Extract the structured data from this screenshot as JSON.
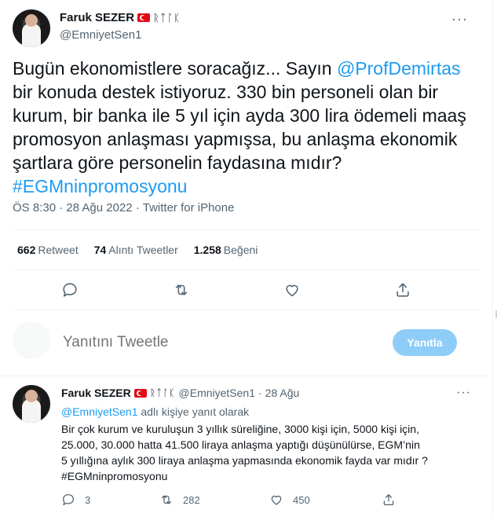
{
  "tweet": {
    "author": {
      "name": "Faruk SEZER",
      "script_text": "ᚱᛏᛚᛕ",
      "handle": "@EmniyetSen1"
    },
    "more_label": "···",
    "text_before_mention": "Bugün ekonomistlere soracağız... Sayın ",
    "mention": "@ProfDemirtas",
    "text_after_mention": " bir konuda destek istiyoruz. 330 bin personeli olan bir kurum, bir banka ile 5 yıl için ayda 300 lira ödemeli maaş promosyon anlaşması yapmışsa, bu anlaşma ekonomik şartlara göre personelin faydasına mıdır?",
    "hashtag": "#EGMninpromosyonu",
    "time": "ÖS 8:30",
    "separator": "·",
    "date": "28 Ağu 2022",
    "source": "Twitter for iPhone",
    "stats": {
      "retweets_count": "662",
      "retweets_label": "Retweet",
      "quotes_count": "74",
      "quotes_label": "Alıntı Tweetler",
      "likes_count": "1.258",
      "likes_label": "Beğeni"
    },
    "actions": [
      "reply-icon",
      "retweet-icon",
      "like-icon",
      "share-icon"
    ]
  },
  "compose": {
    "placeholder": "Yanıtını Tweetle",
    "button_label": "Yanıtla"
  },
  "reply": {
    "author": {
      "name": "Faruk SEZER",
      "script_text": "ᚱᛏᛚᛕ",
      "handle": "@EmniyetSen1"
    },
    "separator": "·",
    "date": "28 Ağu",
    "more_label": "···",
    "replying_to_handle": "@EmniyetSen1",
    "replying_to_suffix": " adlı kişiye yanıt olarak",
    "lines": [
      "Bir çok kurum ve kuruluşun 3 yıllık süreliğine, 3000 kişi için, 5000 kişi için,",
      "25.000, 30.000 hatta 41.500 liraya anlaşma yaptığı düşünülürse, EGM’nin",
      "5 yıllığına aylık 300 liraya anlaşma yapmasında ekonomik fayda var mıdır ?"
    ],
    "hashtag": "#EGMninpromosyonu",
    "reply_count": "3",
    "retweet_count": "282",
    "like_count": "450"
  },
  "colors": {
    "accent": "#1d9bf0",
    "text": "#0f1419",
    "muted": "#536471",
    "button_disabled": "#8ecdf8",
    "flag_red": "#e30a17"
  }
}
